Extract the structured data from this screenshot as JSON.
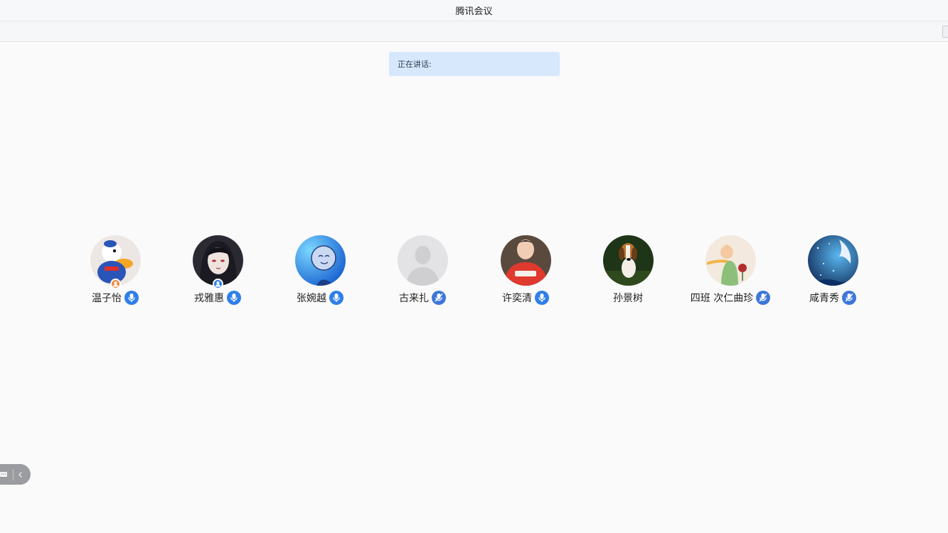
{
  "window": {
    "title": "腾讯会议"
  },
  "speaking": {
    "label": "正在讲话:"
  },
  "participants": [
    {
      "name": "温子怡",
      "avatar": "donald-duck-avatar",
      "role": "host",
      "mic": "on"
    },
    {
      "name": "戎雅惠",
      "avatar": "anime-woman-avatar",
      "role": "cohost",
      "mic": "on"
    },
    {
      "name": "张婉越",
      "avatar": "blue-balloon-avatar",
      "role": "none",
      "mic": "on"
    },
    {
      "name": "古来扎",
      "avatar": "default-person-avatar",
      "role": "none",
      "mic": "off"
    },
    {
      "name": "许奕清",
      "avatar": "man-red-jacket-avatar",
      "role": "none",
      "mic": "on"
    },
    {
      "name": "孙景树",
      "avatar": "beagle-dog-avatar",
      "role": "none",
      "mic": "none"
    },
    {
      "name": "四班 次仁曲珍",
      "avatar": "little-prince-avatar",
      "role": "none",
      "mic": "off"
    },
    {
      "name": "咸青秀",
      "avatar": "night-sky-avatar",
      "role": "none",
      "mic": "off"
    }
  ],
  "colors": {
    "accent": "#2f7fe8",
    "speaking_bg": "#d7e8fd",
    "host_badge": "#f08a3c"
  }
}
